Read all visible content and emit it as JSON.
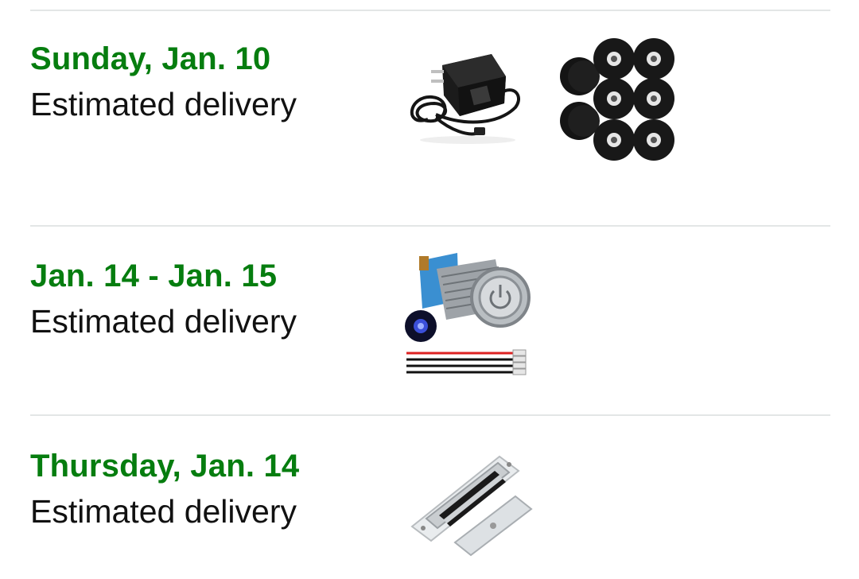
{
  "shipments": [
    {
      "date": "Sunday, Jan. 10",
      "label": "Estimated delivery",
      "items": [
        "power-adapter",
        "rubber-feet"
      ]
    },
    {
      "date": "Jan. 14 - Jan. 15",
      "label": "Estimated delivery",
      "items": [
        "push-button-switch"
      ]
    },
    {
      "date": "Thursday, Jan. 14",
      "label": "Estimated delivery",
      "items": [
        "magnetic-lock"
      ]
    }
  ],
  "colors": {
    "date_green": "#067d0f",
    "text": "#111111",
    "divider": "#e3e6e6"
  }
}
